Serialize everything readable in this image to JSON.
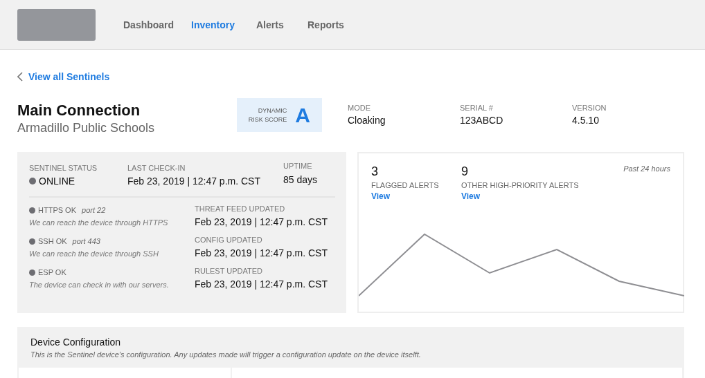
{
  "nav": {
    "tabs": [
      {
        "label": "Dashboard",
        "selected": false
      },
      {
        "label": "Inventory",
        "selected": true
      },
      {
        "label": "Alerts",
        "selected": false
      },
      {
        "label": "Reports",
        "selected": false
      }
    ]
  },
  "back_link": "View all Sentinels",
  "device": {
    "name": "Main Connection",
    "organization": "Armadillo Public Schools"
  },
  "risk_score": {
    "label_line1": "DYNAMIC",
    "label_line2": "RISK SCORE",
    "grade": "A"
  },
  "facts": [
    {
      "label": "MODE",
      "value": "Cloaking"
    },
    {
      "label": "SERIAL #",
      "value": "123ABCD"
    },
    {
      "label": "VERSION",
      "value": "4.5.10"
    }
  ],
  "status": {
    "sentinel_status_label": "SENTINEL STATUS",
    "sentinel_status": "ONLINE",
    "last_checkin_label": "LAST CHECK-IN",
    "last_checkin": "Feb 23, 2019 | 12:47 p.m. CST",
    "uptime_label": "UPTIME",
    "uptime": "85 days"
  },
  "checks": [
    {
      "name": "HTTPS OK",
      "port": "port 22",
      "description": "We can reach the device through HTTPS"
    },
    {
      "name": "SSH OK",
      "port": "port 443",
      "description": "We can reach the device through SSH"
    },
    {
      "name": "ESP OK",
      "description": "The device can check in with our servers."
    }
  ],
  "updates": [
    {
      "label": "THREAT FEED UPDATED",
      "value": "Feb 23, 2019 | 12:47 p.m. CST"
    },
    {
      "label": "CONFIG UPDATED",
      "value": "Feb 23, 2019 | 12:47 p.m. CST"
    },
    {
      "label": "RULEST UPDATED",
      "value": "Feb 23, 2019 | 12:47 p.m. CST"
    }
  ],
  "alerts": {
    "period": "Past 24 hours",
    "counts": [
      {
        "count": "3",
        "label": "FLAGGED ALERTS",
        "link": "View"
      },
      {
        "count": "9",
        "label": "OTHER HIGH-PRIORITY ALERTS",
        "link": "View"
      }
    ]
  },
  "configuration": {
    "title": "Device Configuration",
    "description": "This is the Sentinel device’s configuration. Any updates made will trigger a configuration update on the device itselft."
  }
}
